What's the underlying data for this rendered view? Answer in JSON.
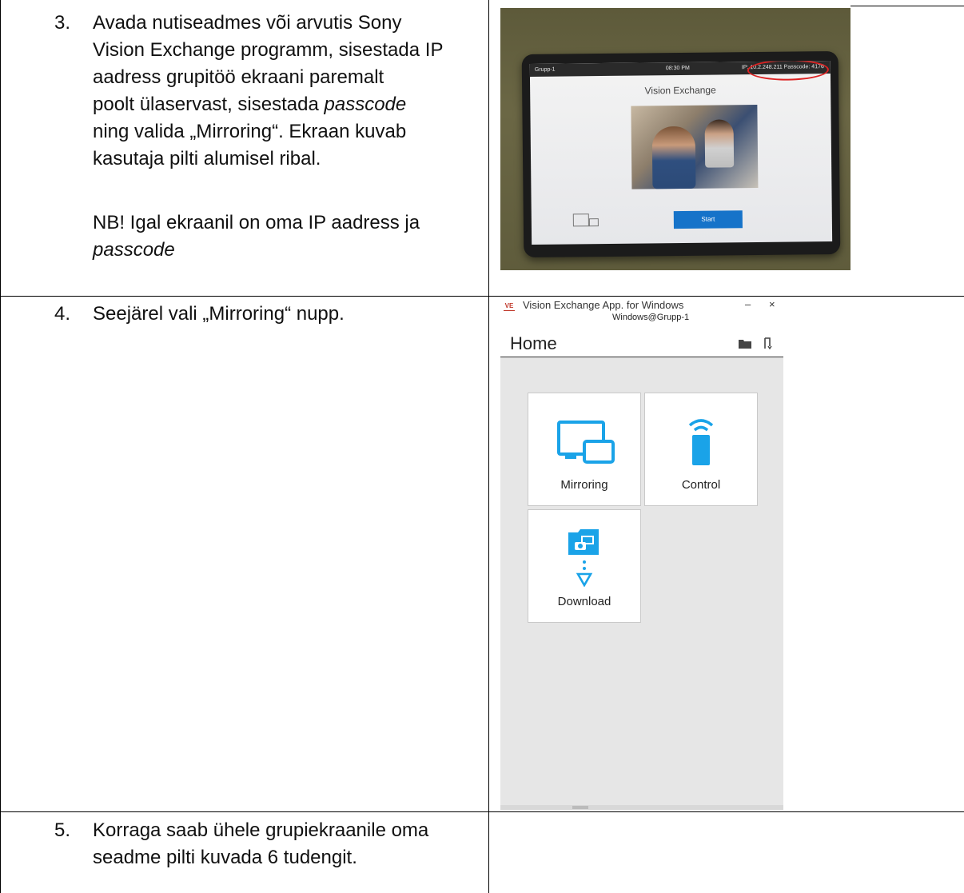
{
  "rows": [
    {
      "number": "3.",
      "lines": [
        "Avada nutiseadmes või arvutis Sony",
        "Vision Exchange programm, sisestada IP",
        "aadress grupitöö ekraani paremalt",
        [
          "poolt ülaservast, sisestada ",
          {
            "italic": "passcode"
          }
        ],
        "ning valida „Mirroring“. Ekraan kuvab",
        "kasutaja pilti alumisel ribal."
      ],
      "note_line1": "NB! Igal ekraanil on oma IP aadress ja",
      "note_line2": "passcode"
    },
    {
      "number": "4.",
      "text": "Seejärel vali „Mirroring“ nupp."
    },
    {
      "number": "5.",
      "line1": "Korraga saab ühele grupiekraanile oma",
      "line2": "seadme pilti kuvada 6 tudengit."
    }
  ],
  "row1_text": {
    "l1": "Avada nutiseadmes või arvutis Sony",
    "l2": "Vision Exchange programm, sisestada IP",
    "l3": "aadress grupitöö ekraani paremalt",
    "l4a": "poolt ülaservast, sisestada ",
    "l4b": "passcode",
    "l5": "ning valida „Mirroring“. Ekraan kuvab",
    "l6": "kasutaja pilti alumisel ribal."
  },
  "photo": {
    "topbar_left": "Grupp-1",
    "topbar_mid": "08:30 PM",
    "topbar_right": "IP: 10.2.248.211  Passcode: 4176",
    "screen_title": "Vision Exchange",
    "start_label": "Start"
  },
  "app": {
    "logo": "VE",
    "window_title": "Vision Exchange App. for Windows",
    "subtitle": "Windows@Grupp-1",
    "minimize": "–",
    "close": "×",
    "header_title": "Home",
    "tiles": [
      {
        "label": "Mirroring",
        "icon": "mirroring-icon"
      },
      {
        "label": "Control",
        "icon": "remote-control-icon"
      },
      {
        "label": "Download",
        "icon": "download-icon"
      }
    ],
    "accent_color": "#1aa3e8"
  }
}
